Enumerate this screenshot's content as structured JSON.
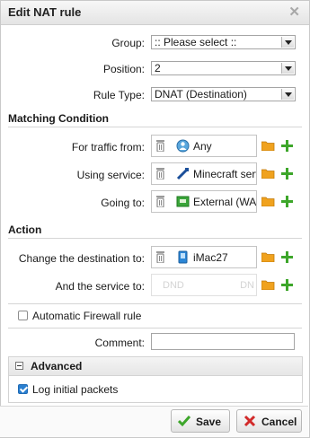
{
  "dialog": {
    "title": "Edit NAT rule"
  },
  "fields": {
    "group": {
      "label": "Group:",
      "value": ":: Please select ::"
    },
    "position": {
      "label": "Position:",
      "value": "2"
    },
    "rule_type": {
      "label": "Rule Type:",
      "value": "DNAT (Destination)"
    }
  },
  "matching": {
    "heading": "Matching Condition",
    "traffic_from": {
      "label": "For traffic from:",
      "value": "Any"
    },
    "using_service": {
      "label": "Using service:",
      "value": "Minecraft server"
    },
    "going_to": {
      "label": "Going to:",
      "value": "External (WAN)"
    }
  },
  "action": {
    "heading": "Action",
    "change_dest": {
      "label": "Change the destination to:",
      "value": "iMac27"
    },
    "service_to": {
      "label": "And the service to:",
      "placeholder": "DND",
      "placeholder_right": "DN"
    }
  },
  "auto_firewall": {
    "label": "Automatic Firewall rule",
    "checked": false
  },
  "comment": {
    "label": "Comment:",
    "value": ""
  },
  "advanced": {
    "heading": "Advanced",
    "log_label": "Log initial packets",
    "log_checked": true
  },
  "buttons": {
    "save": "Save",
    "cancel": "Cancel"
  },
  "colors": {
    "accent_green": "#3da62a",
    "cancel_red": "#d22a2a",
    "folder_orange": "#f0a21e",
    "check_blue": "#2a7fd0"
  }
}
